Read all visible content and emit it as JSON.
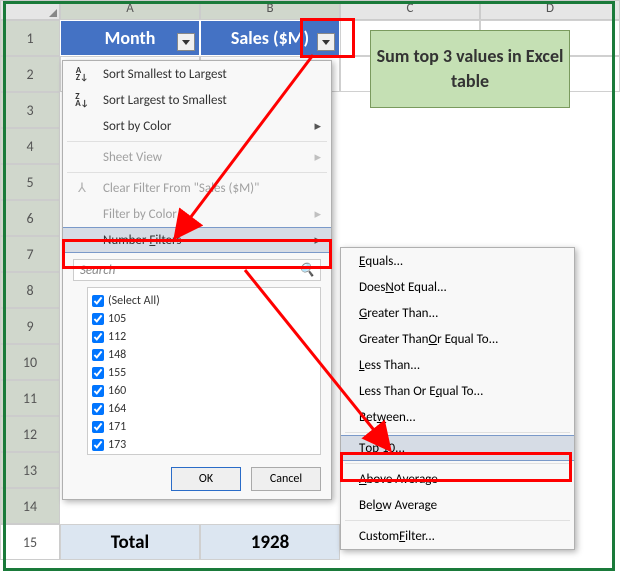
{
  "columns": [
    "A",
    "B",
    "C",
    "D"
  ],
  "rows": [
    "1",
    "2",
    "3",
    "4",
    "5",
    "6",
    "7",
    "8",
    "9",
    "10",
    "11",
    "12",
    "13",
    "14",
    "15"
  ],
  "table": {
    "headers": {
      "month": "Month",
      "sales": "Sales ($M)"
    },
    "total": {
      "label": "Total",
      "value": "1928"
    }
  },
  "callout": "Sum top 3 values in Excel table",
  "menu": {
    "sort_asc": "Sort Smallest to Largest",
    "sort_desc": "Sort Largest to Smallest",
    "sort_color": "Sort by Color",
    "sheet_view": "Sheet View",
    "clear_filter": "Clear Filter From \"Sales ($M)\"",
    "filter_color": "Filter by Color",
    "number_filters": "Number Filters",
    "search_placeholder": "Search",
    "checklist": [
      "(Select All)",
      "105",
      "112",
      "148",
      "155",
      "160",
      "164",
      "171",
      "173"
    ],
    "ok": "OK",
    "cancel": "Cancel"
  },
  "submenu": {
    "equals": "Equals...",
    "not_equal": "Does Not Equal...",
    "greater": "Greater Than...",
    "greater_eq": "Greater Than Or Equal To...",
    "less": "Less Than...",
    "less_eq": "Less Than Or Equal To...",
    "between": "Between...",
    "top10": "Top 10...",
    "above_avg": "Above Average",
    "below_avg": "Below Average",
    "custom": "Custom Filter..."
  }
}
